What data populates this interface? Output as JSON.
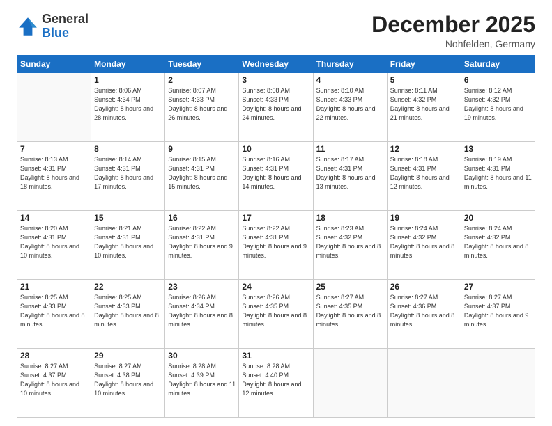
{
  "header": {
    "logo_general": "General",
    "logo_blue": "Blue",
    "month_title": "December 2025",
    "location": "Nohfelden, Germany"
  },
  "days_of_week": [
    "Sunday",
    "Monday",
    "Tuesday",
    "Wednesday",
    "Thursday",
    "Friday",
    "Saturday"
  ],
  "weeks": [
    [
      {
        "day": "",
        "info": ""
      },
      {
        "day": "1",
        "info": "Sunrise: 8:06 AM\nSunset: 4:34 PM\nDaylight: 8 hours\nand 28 minutes."
      },
      {
        "day": "2",
        "info": "Sunrise: 8:07 AM\nSunset: 4:33 PM\nDaylight: 8 hours\nand 26 minutes."
      },
      {
        "day": "3",
        "info": "Sunrise: 8:08 AM\nSunset: 4:33 PM\nDaylight: 8 hours\nand 24 minutes."
      },
      {
        "day": "4",
        "info": "Sunrise: 8:10 AM\nSunset: 4:33 PM\nDaylight: 8 hours\nand 22 minutes."
      },
      {
        "day": "5",
        "info": "Sunrise: 8:11 AM\nSunset: 4:32 PM\nDaylight: 8 hours\nand 21 minutes."
      },
      {
        "day": "6",
        "info": "Sunrise: 8:12 AM\nSunset: 4:32 PM\nDaylight: 8 hours\nand 19 minutes."
      }
    ],
    [
      {
        "day": "7",
        "info": "Sunrise: 8:13 AM\nSunset: 4:31 PM\nDaylight: 8 hours\nand 18 minutes."
      },
      {
        "day": "8",
        "info": "Sunrise: 8:14 AM\nSunset: 4:31 PM\nDaylight: 8 hours\nand 17 minutes."
      },
      {
        "day": "9",
        "info": "Sunrise: 8:15 AM\nSunset: 4:31 PM\nDaylight: 8 hours\nand 15 minutes."
      },
      {
        "day": "10",
        "info": "Sunrise: 8:16 AM\nSunset: 4:31 PM\nDaylight: 8 hours\nand 14 minutes."
      },
      {
        "day": "11",
        "info": "Sunrise: 8:17 AM\nSunset: 4:31 PM\nDaylight: 8 hours\nand 13 minutes."
      },
      {
        "day": "12",
        "info": "Sunrise: 8:18 AM\nSunset: 4:31 PM\nDaylight: 8 hours\nand 12 minutes."
      },
      {
        "day": "13",
        "info": "Sunrise: 8:19 AM\nSunset: 4:31 PM\nDaylight: 8 hours\nand 11 minutes."
      }
    ],
    [
      {
        "day": "14",
        "info": "Sunrise: 8:20 AM\nSunset: 4:31 PM\nDaylight: 8 hours\nand 10 minutes."
      },
      {
        "day": "15",
        "info": "Sunrise: 8:21 AM\nSunset: 4:31 PM\nDaylight: 8 hours\nand 10 minutes."
      },
      {
        "day": "16",
        "info": "Sunrise: 8:22 AM\nSunset: 4:31 PM\nDaylight: 8 hours\nand 9 minutes."
      },
      {
        "day": "17",
        "info": "Sunrise: 8:22 AM\nSunset: 4:31 PM\nDaylight: 8 hours\nand 9 minutes."
      },
      {
        "day": "18",
        "info": "Sunrise: 8:23 AM\nSunset: 4:32 PM\nDaylight: 8 hours\nand 8 minutes."
      },
      {
        "day": "19",
        "info": "Sunrise: 8:24 AM\nSunset: 4:32 PM\nDaylight: 8 hours\nand 8 minutes."
      },
      {
        "day": "20",
        "info": "Sunrise: 8:24 AM\nSunset: 4:32 PM\nDaylight: 8 hours\nand 8 minutes."
      }
    ],
    [
      {
        "day": "21",
        "info": "Sunrise: 8:25 AM\nSunset: 4:33 PM\nDaylight: 8 hours\nand 8 minutes."
      },
      {
        "day": "22",
        "info": "Sunrise: 8:25 AM\nSunset: 4:33 PM\nDaylight: 8 hours\nand 8 minutes."
      },
      {
        "day": "23",
        "info": "Sunrise: 8:26 AM\nSunset: 4:34 PM\nDaylight: 8 hours\nand 8 minutes."
      },
      {
        "day": "24",
        "info": "Sunrise: 8:26 AM\nSunset: 4:35 PM\nDaylight: 8 hours\nand 8 minutes."
      },
      {
        "day": "25",
        "info": "Sunrise: 8:27 AM\nSunset: 4:35 PM\nDaylight: 8 hours\nand 8 minutes."
      },
      {
        "day": "26",
        "info": "Sunrise: 8:27 AM\nSunset: 4:36 PM\nDaylight: 8 hours\nand 8 minutes."
      },
      {
        "day": "27",
        "info": "Sunrise: 8:27 AM\nSunset: 4:37 PM\nDaylight: 8 hours\nand 9 minutes."
      }
    ],
    [
      {
        "day": "28",
        "info": "Sunrise: 8:27 AM\nSunset: 4:37 PM\nDaylight: 8 hours\nand 10 minutes."
      },
      {
        "day": "29",
        "info": "Sunrise: 8:27 AM\nSunset: 4:38 PM\nDaylight: 8 hours\nand 10 minutes."
      },
      {
        "day": "30",
        "info": "Sunrise: 8:28 AM\nSunset: 4:39 PM\nDaylight: 8 hours\nand 11 minutes."
      },
      {
        "day": "31",
        "info": "Sunrise: 8:28 AM\nSunset: 4:40 PM\nDaylight: 8 hours\nand 12 minutes."
      },
      {
        "day": "",
        "info": ""
      },
      {
        "day": "",
        "info": ""
      },
      {
        "day": "",
        "info": ""
      }
    ]
  ]
}
